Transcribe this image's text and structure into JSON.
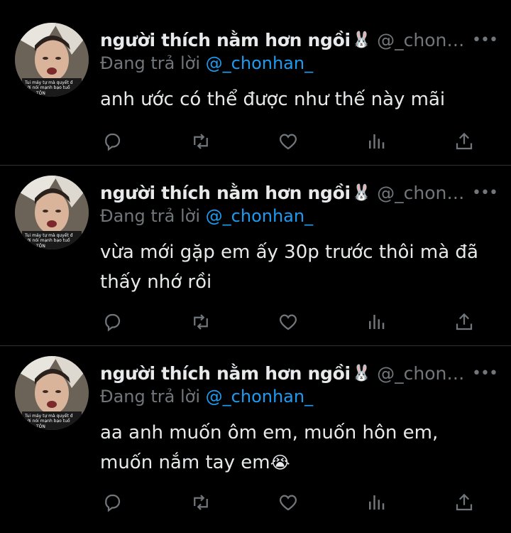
{
  "tweets": [
    {
      "display_name": "người thích nằm hơn ngồi",
      "name_emoji": "🐰",
      "handle": "@_chonhan_",
      "replying_label": "Đang trả lời",
      "replying_to": "@_chonhan_",
      "text_lines": [
        "anh ước có thể được như thế này mãi"
      ],
      "text_emoji": ""
    },
    {
      "display_name": "người thích nằm hơn ngồi",
      "name_emoji": "🐰",
      "handle": "@_chonhan_",
      "replying_label": "Đang trả lời",
      "replying_to": "@_chonhan_",
      "text_lines": [
        "vừa mới gặp em ấy 30p trước thôi mà đã",
        "thấy nhớ rồi"
      ],
      "text_emoji": ""
    },
    {
      "display_name": "người thích nằm hơn ngồi",
      "name_emoji": "🐰",
      "handle": "@_chonhan_",
      "replying_label": "Đang trả lời",
      "replying_to": "@_chonhan_",
      "text_lines": [
        "aa anh muốn ôm em, muốn hôn em,",
        "muốn nắm tay em"
      ],
      "text_emoji": "😭"
    }
  ],
  "avatar_caption": [
    "Tui máy tự mà quyết đ",
    "Lời nói mạnh bạo tuổ",
    "TÔN"
  ],
  "more_glyph": "•••",
  "icons": [
    "reply-icon",
    "retweet-icon",
    "like-icon",
    "views-icon",
    "share-icon"
  ],
  "colors": {
    "background": "#000000",
    "text": "#e7e9ea",
    "secondary": "#71767b",
    "accent": "#1d9bf0",
    "divider": "#2f3336"
  }
}
